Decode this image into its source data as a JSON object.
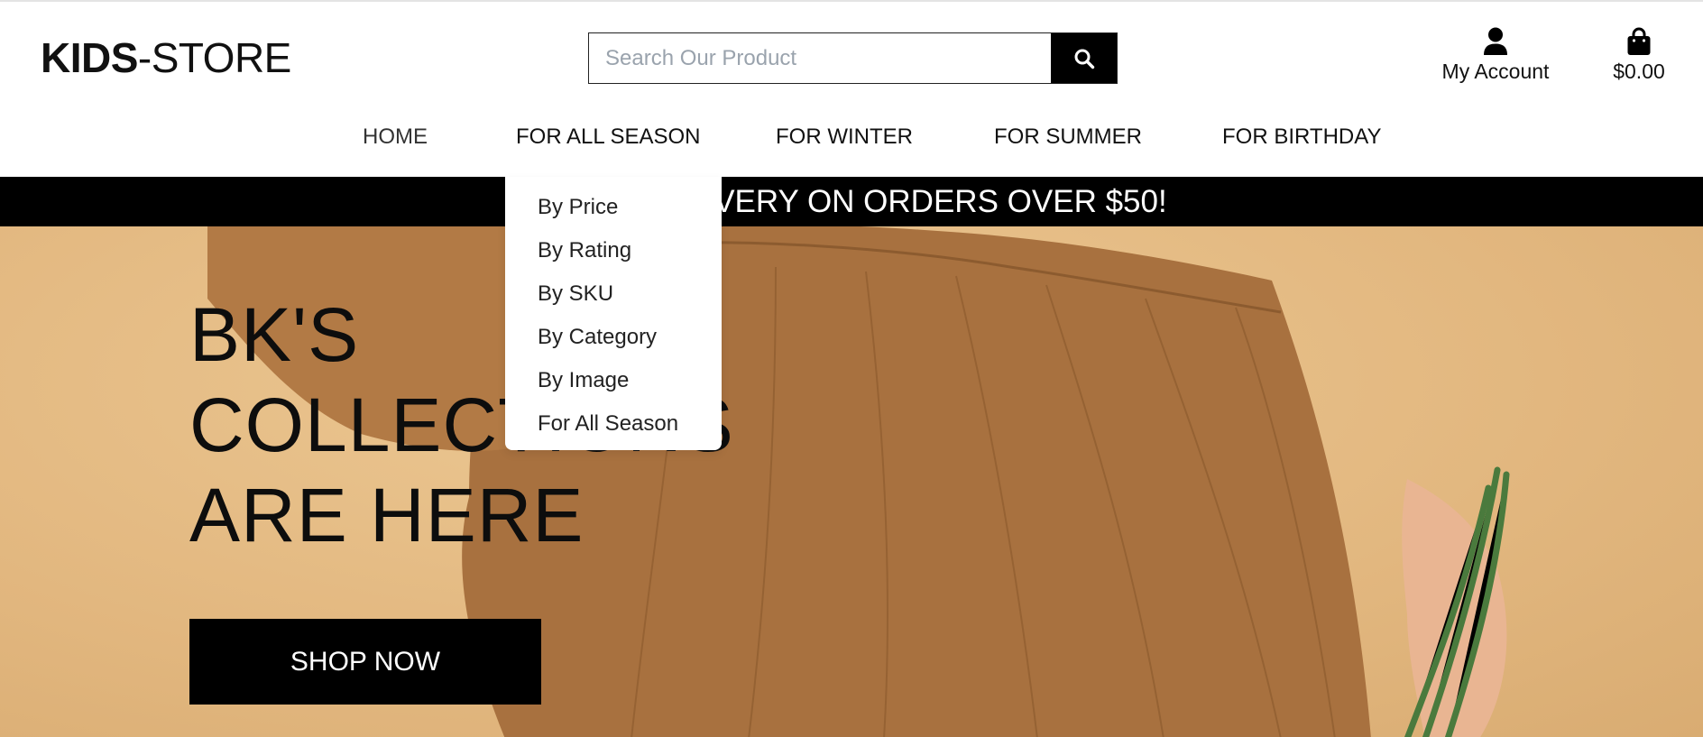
{
  "brand": {
    "bold": "KIDS",
    "rest": "-STORE"
  },
  "search": {
    "placeholder": "Search Our Product",
    "button_icon": "search-icon"
  },
  "account": {
    "label": "My Account",
    "icon": "user-icon"
  },
  "cart": {
    "total": "$0.00",
    "icon": "shopping-bag-icon"
  },
  "nav": {
    "items": [
      {
        "label": "HOME"
      },
      {
        "label": "FOR ALL SEASON"
      },
      {
        "label": "FOR WINTER"
      },
      {
        "label": "FOR SUMMER"
      },
      {
        "label": "FOR BIRTHDAY"
      }
    ]
  },
  "promo": {
    "text": "FREE DELIVERY ON ORDERS OVER $50!"
  },
  "dropdown": {
    "items": [
      {
        "label": "By Price"
      },
      {
        "label": "By Rating"
      },
      {
        "label": "By SKU"
      },
      {
        "label": "By Category"
      },
      {
        "label": "By Image"
      },
      {
        "label": "For All Season"
      }
    ]
  },
  "hero": {
    "lines": [
      "BK'S",
      "COLLECTIONS",
      "ARE HERE"
    ],
    "cta": "SHOP NOW"
  },
  "colors": {
    "accent": "#000000",
    "hero_bg": "#e2b77f",
    "dress": "#a26e3e"
  }
}
